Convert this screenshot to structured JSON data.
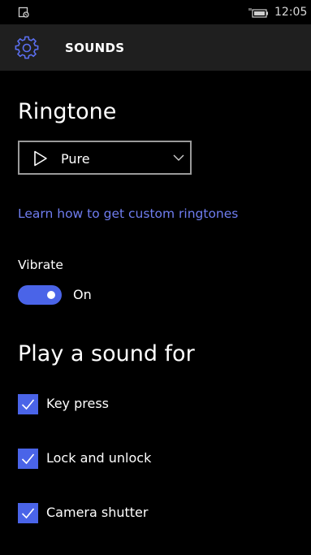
{
  "status_bar": {
    "left_icon": "notification-icon",
    "battery_icon": "battery-charging-icon",
    "time": "12:05"
  },
  "header": {
    "icon": "gear-icon",
    "title": "SOUNDS"
  },
  "ringtone": {
    "title": "Ringtone",
    "selected": "Pure",
    "play_icon": "play-icon",
    "dropdown_icon": "chevron-down-icon",
    "link_text": "Learn how to get custom ringtones"
  },
  "vibrate": {
    "label": "Vibrate",
    "state": "On",
    "on": true
  },
  "play_sound": {
    "title": "Play a sound for",
    "items": [
      {
        "label": "Key press",
        "checked": true
      },
      {
        "label": "Lock and unlock",
        "checked": true
      },
      {
        "label": "Camera shutter",
        "checked": true
      }
    ]
  },
  "colors": {
    "accent": "#4a64e8",
    "link": "#6f7df0",
    "header_bg": "#1f1f1f",
    "background": "#000000"
  }
}
